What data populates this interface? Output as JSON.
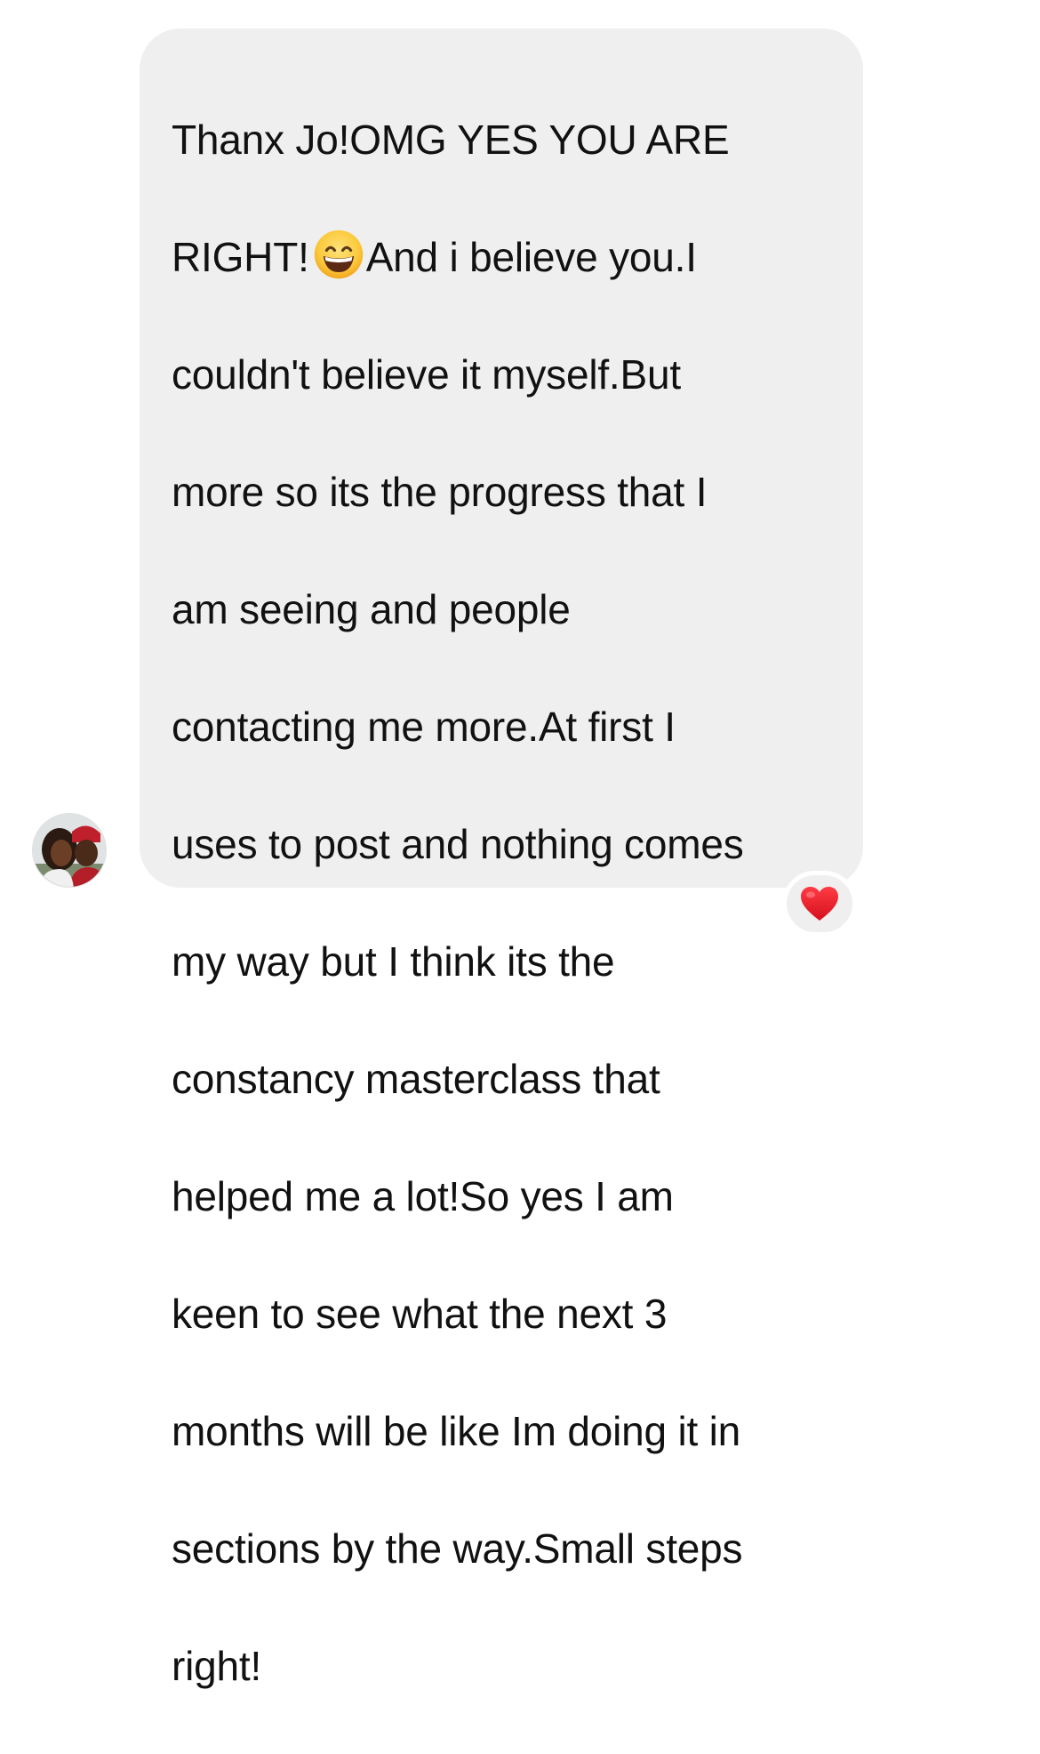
{
  "message": {
    "lines": [
      "Thanx Jo!OMG YES YOU ARE",
      "RIGHT!",
      "And i believe you.I",
      "couldn't believe it myself.But",
      "more so its the progress that I",
      "am seeing and people",
      "contacting me more.At first I",
      "uses to post and nothing comes",
      "my way but I think its the",
      "constancy masterclass that",
      "helped me a lot!So yes I am",
      "keen to see what the next 3",
      "months will be like Im doing it in",
      "sections by the way.Small steps",
      "right!"
    ],
    "inline_emoji": "grinning-face-with-smiling-eyes",
    "bubble_color": "#efefef",
    "text_color": "#111111"
  },
  "sender": {
    "avatar_icon": "profile-photo-couple"
  },
  "reaction": {
    "icon": "red-heart-icon",
    "color": "#e8212f"
  }
}
